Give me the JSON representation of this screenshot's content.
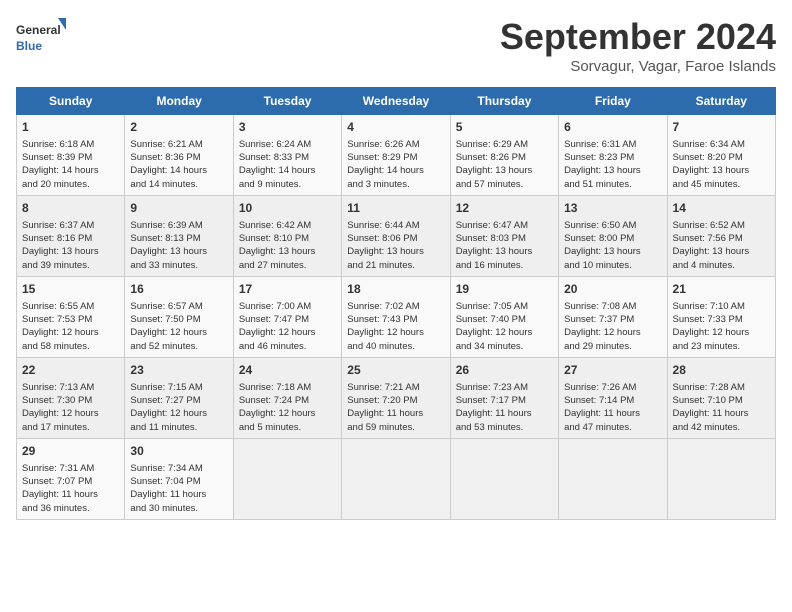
{
  "logo": {
    "text_general": "General",
    "text_blue": "Blue"
  },
  "title": "September 2024",
  "location": "Sorvagur, Vagar, Faroe Islands",
  "days_of_week": [
    "Sunday",
    "Monday",
    "Tuesday",
    "Wednesday",
    "Thursday",
    "Friday",
    "Saturday"
  ],
  "weeks": [
    [
      {
        "day": 1,
        "info": "Sunrise: 6:18 AM\nSunset: 8:39 PM\nDaylight: 14 hours\nand 20 minutes."
      },
      {
        "day": 2,
        "info": "Sunrise: 6:21 AM\nSunset: 8:36 PM\nDaylight: 14 hours\nand 14 minutes."
      },
      {
        "day": 3,
        "info": "Sunrise: 6:24 AM\nSunset: 8:33 PM\nDaylight: 14 hours\nand 9 minutes."
      },
      {
        "day": 4,
        "info": "Sunrise: 6:26 AM\nSunset: 8:29 PM\nDaylight: 14 hours\nand 3 minutes."
      },
      {
        "day": 5,
        "info": "Sunrise: 6:29 AM\nSunset: 8:26 PM\nDaylight: 13 hours\nand 57 minutes."
      },
      {
        "day": 6,
        "info": "Sunrise: 6:31 AM\nSunset: 8:23 PM\nDaylight: 13 hours\nand 51 minutes."
      },
      {
        "day": 7,
        "info": "Sunrise: 6:34 AM\nSunset: 8:20 PM\nDaylight: 13 hours\nand 45 minutes."
      }
    ],
    [
      {
        "day": 8,
        "info": "Sunrise: 6:37 AM\nSunset: 8:16 PM\nDaylight: 13 hours\nand 39 minutes."
      },
      {
        "day": 9,
        "info": "Sunrise: 6:39 AM\nSunset: 8:13 PM\nDaylight: 13 hours\nand 33 minutes."
      },
      {
        "day": 10,
        "info": "Sunrise: 6:42 AM\nSunset: 8:10 PM\nDaylight: 13 hours\nand 27 minutes."
      },
      {
        "day": 11,
        "info": "Sunrise: 6:44 AM\nSunset: 8:06 PM\nDaylight: 13 hours\nand 21 minutes."
      },
      {
        "day": 12,
        "info": "Sunrise: 6:47 AM\nSunset: 8:03 PM\nDaylight: 13 hours\nand 16 minutes."
      },
      {
        "day": 13,
        "info": "Sunrise: 6:50 AM\nSunset: 8:00 PM\nDaylight: 13 hours\nand 10 minutes."
      },
      {
        "day": 14,
        "info": "Sunrise: 6:52 AM\nSunset: 7:56 PM\nDaylight: 13 hours\nand 4 minutes."
      }
    ],
    [
      {
        "day": 15,
        "info": "Sunrise: 6:55 AM\nSunset: 7:53 PM\nDaylight: 12 hours\nand 58 minutes."
      },
      {
        "day": 16,
        "info": "Sunrise: 6:57 AM\nSunset: 7:50 PM\nDaylight: 12 hours\nand 52 minutes."
      },
      {
        "day": 17,
        "info": "Sunrise: 7:00 AM\nSunset: 7:47 PM\nDaylight: 12 hours\nand 46 minutes."
      },
      {
        "day": 18,
        "info": "Sunrise: 7:02 AM\nSunset: 7:43 PM\nDaylight: 12 hours\nand 40 minutes."
      },
      {
        "day": 19,
        "info": "Sunrise: 7:05 AM\nSunset: 7:40 PM\nDaylight: 12 hours\nand 34 minutes."
      },
      {
        "day": 20,
        "info": "Sunrise: 7:08 AM\nSunset: 7:37 PM\nDaylight: 12 hours\nand 29 minutes."
      },
      {
        "day": 21,
        "info": "Sunrise: 7:10 AM\nSunset: 7:33 PM\nDaylight: 12 hours\nand 23 minutes."
      }
    ],
    [
      {
        "day": 22,
        "info": "Sunrise: 7:13 AM\nSunset: 7:30 PM\nDaylight: 12 hours\nand 17 minutes."
      },
      {
        "day": 23,
        "info": "Sunrise: 7:15 AM\nSunset: 7:27 PM\nDaylight: 12 hours\nand 11 minutes."
      },
      {
        "day": 24,
        "info": "Sunrise: 7:18 AM\nSunset: 7:24 PM\nDaylight: 12 hours\nand 5 minutes."
      },
      {
        "day": 25,
        "info": "Sunrise: 7:21 AM\nSunset: 7:20 PM\nDaylight: 11 hours\nand 59 minutes."
      },
      {
        "day": 26,
        "info": "Sunrise: 7:23 AM\nSunset: 7:17 PM\nDaylight: 11 hours\nand 53 minutes."
      },
      {
        "day": 27,
        "info": "Sunrise: 7:26 AM\nSunset: 7:14 PM\nDaylight: 11 hours\nand 47 minutes."
      },
      {
        "day": 28,
        "info": "Sunrise: 7:28 AM\nSunset: 7:10 PM\nDaylight: 11 hours\nand 42 minutes."
      }
    ],
    [
      {
        "day": 29,
        "info": "Sunrise: 7:31 AM\nSunset: 7:07 PM\nDaylight: 11 hours\nand 36 minutes."
      },
      {
        "day": 30,
        "info": "Sunrise: 7:34 AM\nSunset: 7:04 PM\nDaylight: 11 hours\nand 30 minutes."
      },
      null,
      null,
      null,
      null,
      null
    ]
  ]
}
